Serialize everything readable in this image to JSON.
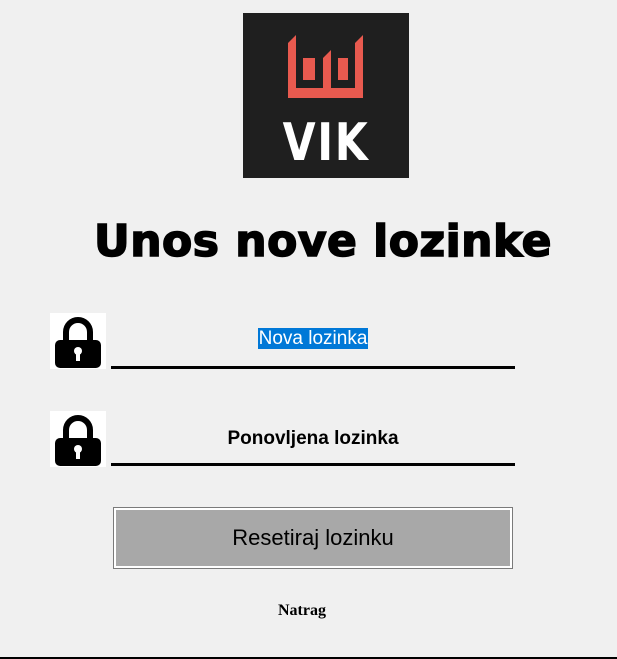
{
  "logo": {
    "text": "VIK",
    "colors": {
      "background": "#1f1f1f",
      "mark": "#e85a4f",
      "text": "#ffffff"
    }
  },
  "title": "Unos nove lozinke",
  "fields": [
    {
      "icon": "lock-icon",
      "value": "Nova lozinka",
      "selected": true
    },
    {
      "icon": "lock-icon",
      "value": "Ponovljena lozinka",
      "selected": false
    }
  ],
  "reset_button": {
    "label": "Resetiraj lozinku"
  },
  "back_link": {
    "label": "Natrag"
  },
  "colors": {
    "selection": "#0078d7",
    "button": "#a8a8a8",
    "background": "#f0f0f0"
  }
}
